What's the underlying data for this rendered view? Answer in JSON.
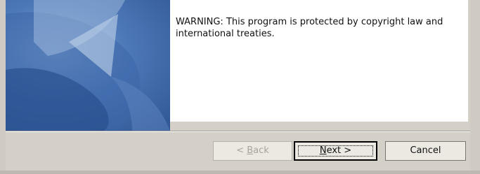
{
  "content": {
    "warning": "WARNING: This program is protected by copyright law and international treaties."
  },
  "buttons": {
    "back": {
      "prefix": "< ",
      "mnemonic": "B",
      "rest": "ack",
      "enabled": false
    },
    "next": {
      "mnemonic": "N",
      "rest": "ext >",
      "default": true
    },
    "cancel": {
      "label": "Cancel"
    }
  },
  "banner": {
    "icon": "installer-swoosh-graphic"
  }
}
